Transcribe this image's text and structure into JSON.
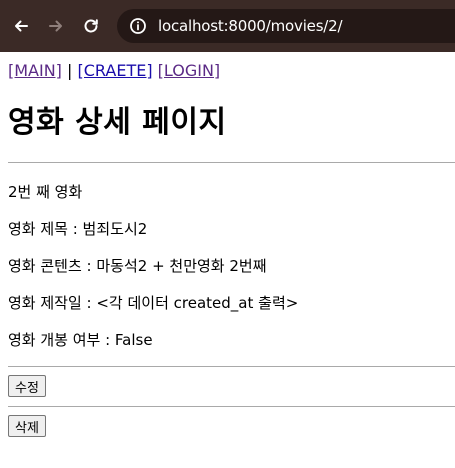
{
  "browser": {
    "back_icon": "arrow-left-icon",
    "forward_icon": "arrow-right-icon",
    "reload_icon": "reload-icon",
    "site_info_icon": "site-info-icon",
    "url_host": "localhost",
    "url_path": ":8000/movies/2/"
  },
  "nav": {
    "main": "[MAIN]",
    "separator": "|",
    "create": "[CRAETE]",
    "login": "[LOGIN]"
  },
  "page": {
    "title": "영화 상세 페이지",
    "lines": [
      "2번 째 영화",
      "영화 제목 : 범죄도시2",
      "영화 콘텐츠 : 마동석2 + 천만영화 2번째",
      "영화 제작일 : <각 데이터 created_at 출력>",
      "영화 개봉 여부 : False"
    ],
    "edit_label": "수정",
    "delete_label": "삭제"
  },
  "colors": {
    "toolbar_bg": "#3b2a26",
    "link": "#1a0dab",
    "visited_link": "#5b2a86"
  }
}
